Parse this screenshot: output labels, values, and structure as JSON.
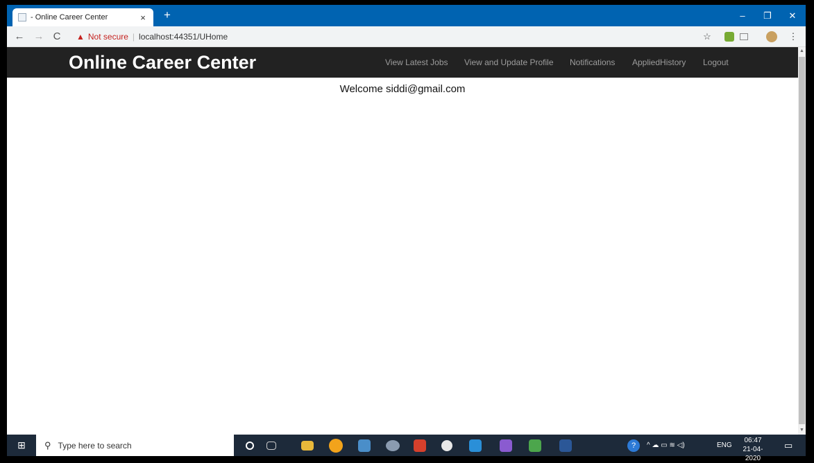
{
  "browser": {
    "tab_title": "- Online Career Center",
    "tab_close": "×",
    "new_tab": "+",
    "window_controls": {
      "minimize": "–",
      "restore": "❐",
      "close": "✕"
    },
    "address": {
      "warning_icon": "▲",
      "security_label": "Not secure",
      "separator": "|",
      "url": "localhost:44351/UHome"
    },
    "nav": {
      "back": "←",
      "forward": "→",
      "reload": "C"
    },
    "toolbar_icons": {
      "star": "☆",
      "menu": "⋮"
    }
  },
  "site": {
    "brand": "Online Career Center",
    "nav_links": [
      "View Latest Jobs",
      "View and Update Profile",
      "Notifications",
      "AppliedHistory",
      "Logout"
    ],
    "welcome": "Welcome siddi@gmail.com"
  },
  "taskbar": {
    "search_placeholder": "Type here to search",
    "language": "ENG",
    "time": "06:47",
    "date": "21-04-2020"
  },
  "colors": {
    "titlebar": "#0063b1",
    "navbar": "#222222",
    "navlink": "#9d9d9d",
    "warning": "#c5221f",
    "taskbar": "#1d2a3a"
  }
}
